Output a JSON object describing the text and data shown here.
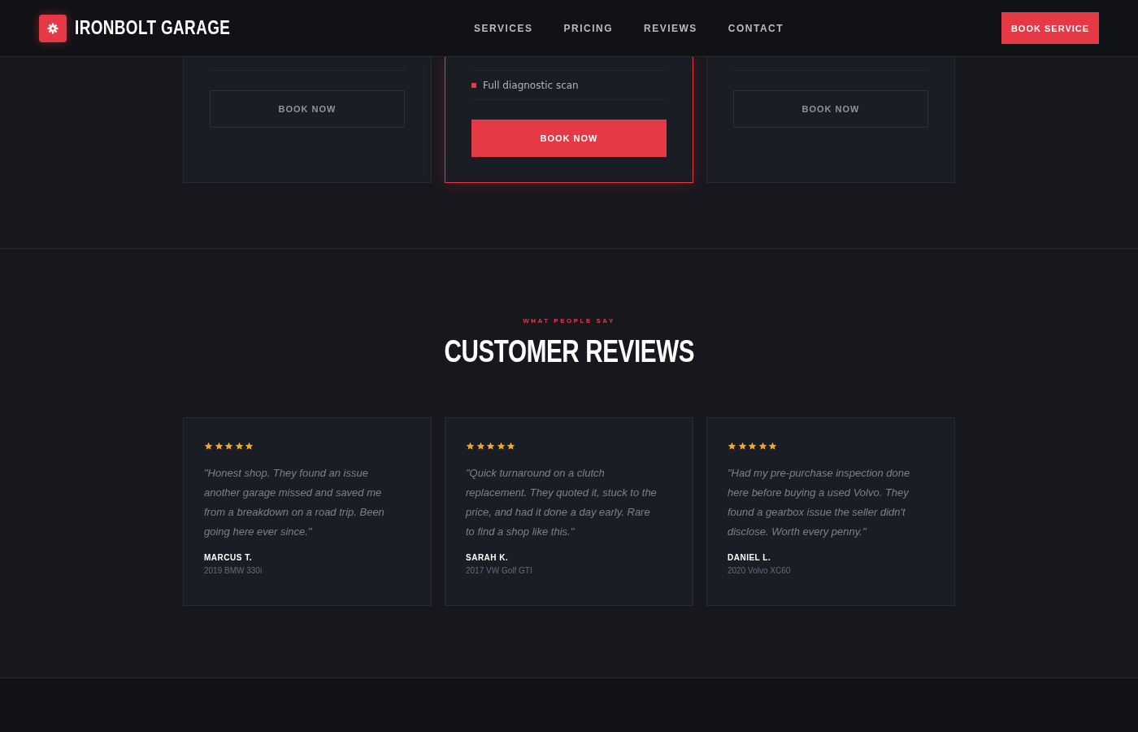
{
  "header": {
    "brand": "IRONBOLT GARAGE",
    "nav": [
      {
        "label": "SERVICES"
      },
      {
        "label": "PRICING"
      },
      {
        "label": "REVIEWS"
      },
      {
        "label": "CONTACT"
      }
    ],
    "cta": "BOOK SERVICE"
  },
  "pricing_cards": [
    {
      "featured": false,
      "button": "BOOK NOW"
    },
    {
      "featured": true,
      "features": [
        "Full diagnostic scan"
      ],
      "button": "BOOK NOW"
    },
    {
      "featured": false,
      "button": "BOOK NOW"
    }
  ],
  "reviews_section": {
    "eyebrow": "WHAT PEOPLE SAY",
    "title": "CUSTOMER REVIEWS",
    "reviews": [
      {
        "stars": 5,
        "quote": "\"Honest shop. They found an issue another garage missed and saved me from a breakdown on a road trip. Been going here ever since.\"",
        "name": "MARCUS T.",
        "car": "2019 BMW 330i"
      },
      {
        "stars": 5,
        "quote": "\"Quick turnaround on a clutch replacement. They quoted it, stuck to the price, and had it done a day early. Rare to find a shop like this.\"",
        "name": "SARAH K.",
        "car": "2017 VW Golf GTI"
      },
      {
        "stars": 5,
        "quote": "\"Had my pre-purchase inspection done here before buying a used Volvo. They found a gearbox issue the seller didn't disclose. Worth every penny.\"",
        "name": "DANIEL L.",
        "car": "2020 Volvo XC60"
      }
    ]
  }
}
